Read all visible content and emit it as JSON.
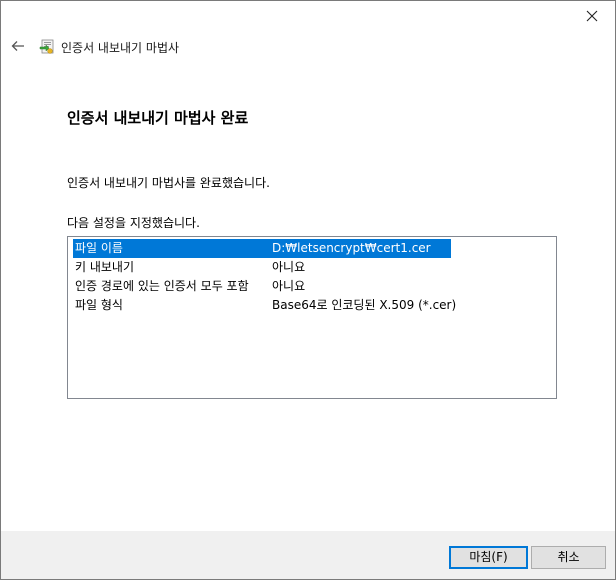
{
  "window": {
    "title": "인증서 내보내기 마법사"
  },
  "main": {
    "heading": "인증서 내보내기 마법사 완료",
    "done_message": "인증서 내보내기 마법사를 완료했습니다.",
    "settings_label": "다음 설정을 지정했습니다.",
    "settings": [
      {
        "name": "파일 이름",
        "value": "D:₩letsencrypt₩cert1.cer",
        "selected": true
      },
      {
        "name": "키 내보내기",
        "value": "아니요",
        "selected": false
      },
      {
        "name": "인증 경로에 있는 인증서 모두 포함",
        "value": "아니요",
        "selected": false
      },
      {
        "name": "파일 형식",
        "value": "Base64로 인코딩된 X.509 (*.cer)",
        "selected": false
      }
    ]
  },
  "footer": {
    "finish_label": "마침(F)",
    "cancel_label": "취소"
  },
  "colors": {
    "selection": "#0078d7",
    "footer_bg": "#f0f0f0"
  }
}
